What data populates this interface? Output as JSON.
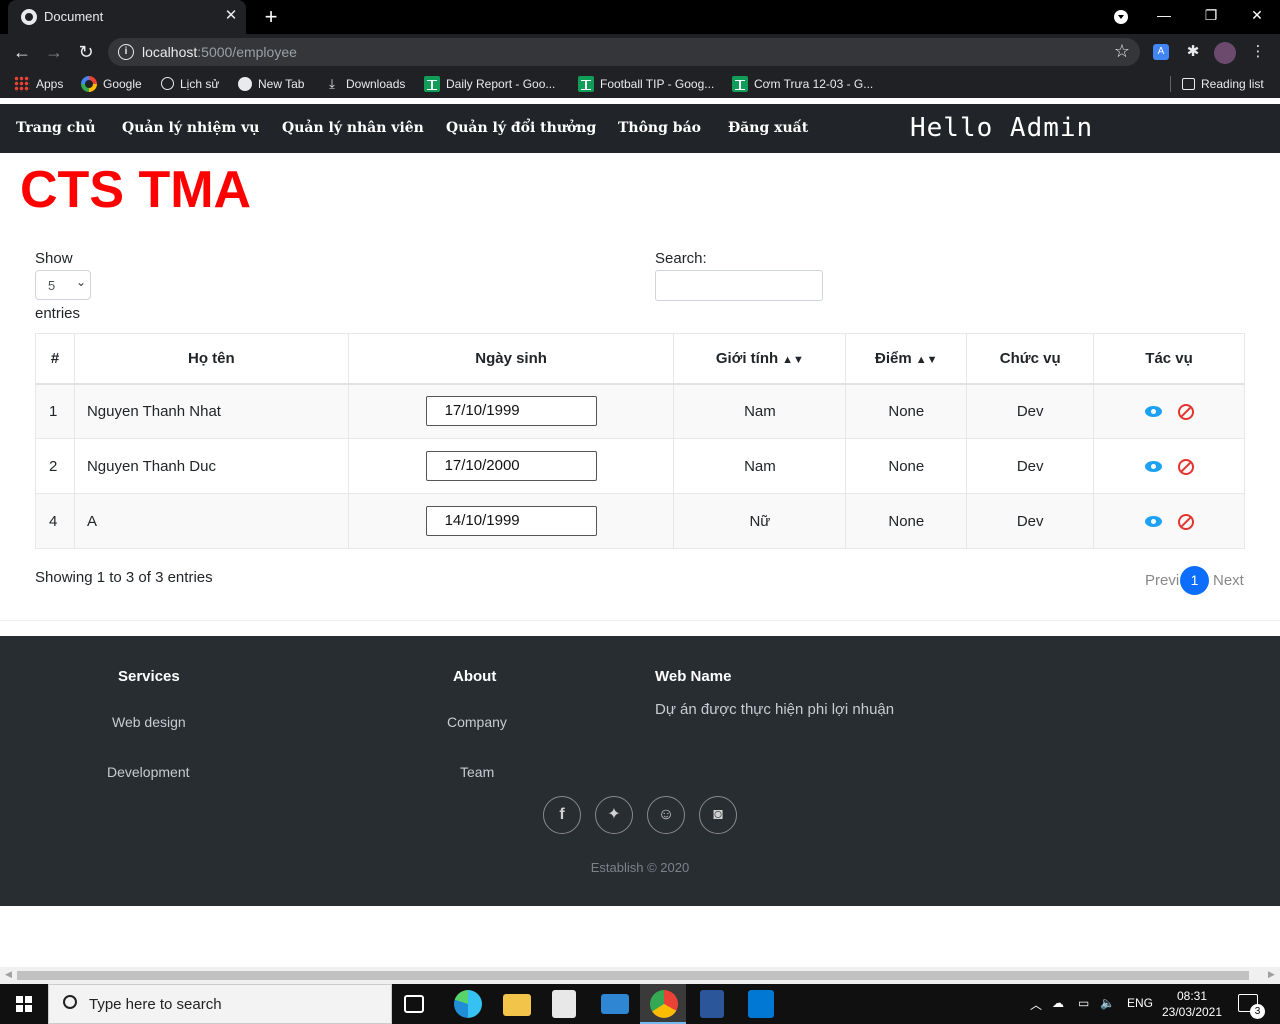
{
  "browser": {
    "tab_title": "Document",
    "url_host": "localhost",
    "url_path": ":5000/employee",
    "bookmarks": [
      "Apps",
      "Google",
      "Lịch sử",
      "New Tab",
      "Downloads",
      "Daily Report - Goo...",
      "Football TIP - Goog...",
      "Cơm Trưa 12-03 - G..."
    ],
    "reading_list": "Reading list"
  },
  "nav": {
    "items": [
      "Trang chủ",
      "Quản lý nhiệm vụ",
      "Quản lý nhân viên",
      "Quản lý đổi thưởng",
      "Thông báo",
      "Đăng xuất"
    ],
    "greeting": "Hello Admin"
  },
  "brand": "CTS TMA",
  "table_controls": {
    "show_label": "Show",
    "page_size": "5",
    "entries_label": "entries",
    "search_label": "Search:",
    "search_value": ""
  },
  "table": {
    "headers": [
      "#",
      "Họ tên",
      "Ngày sinh",
      "Giới tính",
      "Điểm",
      "Chức vụ",
      "Tác vụ"
    ],
    "rows": [
      {
        "id": "1",
        "name": "Nguyen Thanh Nhat",
        "dob": "17/10/1999",
        "gender": "Nam",
        "score": "None",
        "role": "Dev"
      },
      {
        "id": "2",
        "name": "Nguyen Thanh Duc",
        "dob": "17/10/2000",
        "gender": "Nam",
        "score": "None",
        "role": "Dev"
      },
      {
        "id": "4",
        "name": "A",
        "dob": "14/10/1999",
        "gender": "Nữ",
        "score": "None",
        "role": "Dev"
      }
    ]
  },
  "pagination": {
    "info": "Showing 1 to 3 of 3 entries",
    "prev": "Previ",
    "current": "1",
    "next": "Next"
  },
  "footer": {
    "services_heading": "Services",
    "services_links": [
      "Web design",
      "Development"
    ],
    "about_heading": "About",
    "about_links": [
      "Company",
      "Team"
    ],
    "webname_heading": "Web Name",
    "webname_desc": "Dự án được thực hiện phi lợi nhuận",
    "social": [
      "facebook-icon",
      "twitter-icon",
      "snapchat-icon",
      "instagram-icon"
    ],
    "copyright": "Establish © 2020"
  },
  "taskbar": {
    "search_placeholder": "Type here to search",
    "language": "ENG",
    "time": "08:31",
    "date": "23/03/2021",
    "notifications": "3"
  },
  "colors": {
    "brand_red": "#ff0000",
    "navbar_bg": "#212529",
    "footer_bg": "#282d32",
    "page_active": "#0d6efd",
    "view_icon": "#1da1f2",
    "delete_icon": "#e3342f"
  }
}
